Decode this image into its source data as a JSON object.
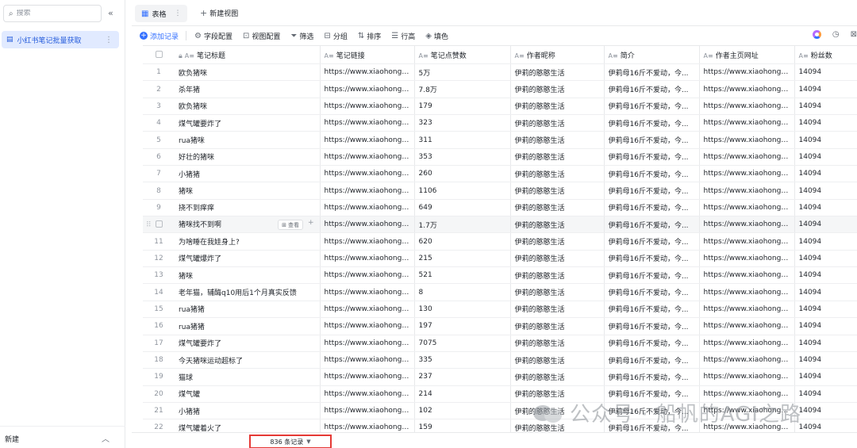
{
  "sidebar": {
    "search_placeholder": "搜索",
    "collapse_glyph": "«",
    "item_label": "小红书笔记批量获取",
    "new_label": "新建"
  },
  "tabs": {
    "active_label": "表格",
    "new_view_label": "新建视图"
  },
  "toolbar": {
    "add_record": "添加记录",
    "field_config": "字段配置",
    "view_config": "视图配置",
    "filter": "筛选",
    "group": "分组",
    "sort": "排序",
    "row_height": "行高",
    "fill": "填色"
  },
  "table": {
    "columns": [
      "笔记标题",
      "笔记链接",
      "笔记点赞数",
      "作者昵称",
      "简介",
      "作者主页网址",
      "粉丝数"
    ],
    "hover_view_label": "查看",
    "rows": [
      {
        "n": "1",
        "title": "欧负猪咪",
        "link": "https://www.xiaohongs...",
        "likes": "5万",
        "author": "伊莉的憨憨生活",
        "intro": "伊莉母16斤不爱动，今...",
        "url": "https://www.xiaohongs...",
        "fans": "14094"
      },
      {
        "n": "2",
        "title": "杀年猪",
        "link": "https://www.xiaohongs...",
        "likes": "7.8万",
        "author": "伊莉的憨憨生活",
        "intro": "伊莉母16斤不爱动，今...",
        "url": "https://www.xiaohongs...",
        "fans": "14094"
      },
      {
        "n": "3",
        "title": "欧负猪咪",
        "link": "https://www.xiaohongs...",
        "likes": "179",
        "author": "伊莉的憨憨生活",
        "intro": "伊莉母16斤不爱动，今...",
        "url": "https://www.xiaohongs...",
        "fans": "14094"
      },
      {
        "n": "4",
        "title": "煤气罐要炸了",
        "link": "https://www.xiaohongs...",
        "likes": "323",
        "author": "伊莉的憨憨生活",
        "intro": "伊莉母16斤不爱动，今...",
        "url": "https://www.xiaohongs...",
        "fans": "14094"
      },
      {
        "n": "5",
        "title": "rua猪咪",
        "link": "https://www.xiaohongs...",
        "likes": "311",
        "author": "伊莉的憨憨生活",
        "intro": "伊莉母16斤不爱动，今...",
        "url": "https://www.xiaohongs...",
        "fans": "14094"
      },
      {
        "n": "6",
        "title": "好壮的猪咪",
        "link": "https://www.xiaohongs...",
        "likes": "353",
        "author": "伊莉的憨憨生活",
        "intro": "伊莉母16斤不爱动，今...",
        "url": "https://www.xiaohongs...",
        "fans": "14094"
      },
      {
        "n": "7",
        "title": "小猪猪",
        "link": "https://www.xiaohongs...",
        "likes": "260",
        "author": "伊莉的憨憨生活",
        "intro": "伊莉母16斤不爱动，今...",
        "url": "https://www.xiaohongs...",
        "fans": "14094"
      },
      {
        "n": "8",
        "title": "猪咪",
        "link": "https://www.xiaohongs...",
        "likes": "1106",
        "author": "伊莉的憨憨生活",
        "intro": "伊莉母16斤不爱动，今...",
        "url": "https://www.xiaohongs...",
        "fans": "14094"
      },
      {
        "n": "9",
        "title": "挠不到痒痒",
        "link": "https://www.xiaohongs...",
        "likes": "649",
        "author": "伊莉的憨憨生活",
        "intro": "伊莉母16斤不爱动，今...",
        "url": "https://www.xiaohongs...",
        "fans": "14094"
      },
      {
        "n": "",
        "title": "猪咪找不到啊",
        "link": "https://www.xiaohongs...",
        "likes": "1.7万",
        "author": "伊莉的憨憨生活",
        "intro": "伊莉母16斤不爱动，今...",
        "url": "https://www.xiaohongs...",
        "fans": "14094"
      },
      {
        "n": "11",
        "title": "为啥睡在我娃身上?",
        "link": "https://www.xiaohongs...",
        "likes": "620",
        "author": "伊莉的憨憨生活",
        "intro": "伊莉母16斤不爱动，今...",
        "url": "https://www.xiaohongs...",
        "fans": "14094"
      },
      {
        "n": "12",
        "title": "煤气罐爆炸了",
        "link": "https://www.xiaohongs...",
        "likes": "215",
        "author": "伊莉的憨憨生活",
        "intro": "伊莉母16斤不爱动，今...",
        "url": "https://www.xiaohongs...",
        "fans": "14094"
      },
      {
        "n": "13",
        "title": "猪咪",
        "link": "https://www.xiaohongs...",
        "likes": "521",
        "author": "伊莉的憨憨生活",
        "intro": "伊莉母16斤不爱动，今...",
        "url": "https://www.xiaohongs...",
        "fans": "14094"
      },
      {
        "n": "14",
        "title": "老年猫，辅酶q10用后1个月真实反馈",
        "link": "https://www.xiaohongs...",
        "likes": "8",
        "author": "伊莉的憨憨生活",
        "intro": "伊莉母16斤不爱动，今...",
        "url": "https://www.xiaohongs...",
        "fans": "14094"
      },
      {
        "n": "15",
        "title": "rua猪猪",
        "link": "https://www.xiaohongs...",
        "likes": "130",
        "author": "伊莉的憨憨生活",
        "intro": "伊莉母16斤不爱动，今...",
        "url": "https://www.xiaohongs...",
        "fans": "14094"
      },
      {
        "n": "16",
        "title": "rua猪猪",
        "link": "https://www.xiaohongs...",
        "likes": "197",
        "author": "伊莉的憨憨生活",
        "intro": "伊莉母16斤不爱动，今...",
        "url": "https://www.xiaohongs...",
        "fans": "14094"
      },
      {
        "n": "17",
        "title": "煤气罐要炸了",
        "link": "https://www.xiaohongs...",
        "likes": "7075",
        "author": "伊莉的憨憨生活",
        "intro": "伊莉母16斤不爱动，今...",
        "url": "https://www.xiaohongs...",
        "fans": "14094"
      },
      {
        "n": "18",
        "title": "今天猪咪运动超标了",
        "link": "https://www.xiaohongs...",
        "likes": "335",
        "author": "伊莉的憨憨生活",
        "intro": "伊莉母16斤不爱动，今...",
        "url": "https://www.xiaohongs...",
        "fans": "14094"
      },
      {
        "n": "19",
        "title": "猫球",
        "link": "https://www.xiaohongs...",
        "likes": "237",
        "author": "伊莉的憨憨生活",
        "intro": "伊莉母16斤不爱动，今...",
        "url": "https://www.xiaohongs...",
        "fans": "14094"
      },
      {
        "n": "20",
        "title": "煤气罐",
        "link": "https://www.xiaohongs...",
        "likes": "214",
        "author": "伊莉的憨憨生活",
        "intro": "伊莉母16斤不爱动，今...",
        "url": "https://www.xiaohongs...",
        "fans": "14094"
      },
      {
        "n": "21",
        "title": "小猪猪",
        "link": "https://www.xiaohongs...",
        "likes": "102",
        "author": "伊莉的憨憨生活",
        "intro": "伊莉母16斤不爱动，今...",
        "url": "https://www.xiaohongs...",
        "fans": "14094"
      },
      {
        "n": "22",
        "title": "煤气罐着火了",
        "link": "https://www.xiaohongs...",
        "likes": "159",
        "author": "伊莉的憨憨生活",
        "intro": "伊莉母16斤不爱动，今...",
        "url": "https://www.xiaohongs...",
        "fans": "14094"
      }
    ]
  },
  "footer": {
    "record_count": "836 条记录"
  },
  "watermark": {
    "text": "公众号 · 船帆的AGI之路"
  }
}
